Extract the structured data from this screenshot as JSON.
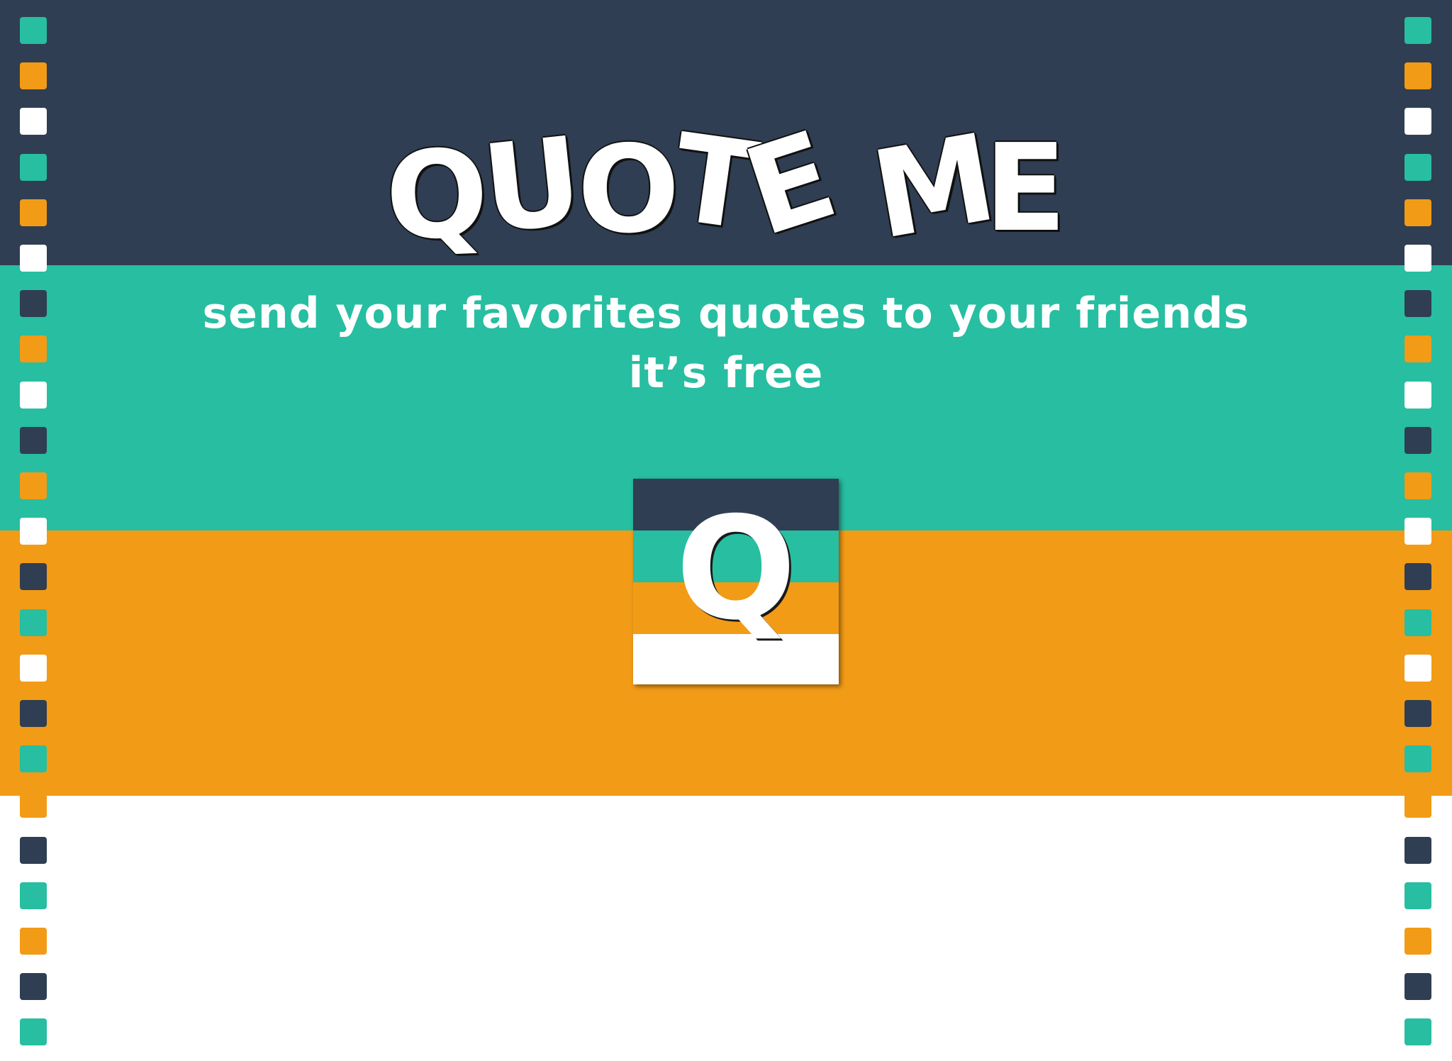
{
  "colors": {
    "navy": "#2f3e52",
    "teal": "#27bea1",
    "orange": "#f29b16",
    "white": "#ffffff"
  },
  "title": {
    "letters": [
      "Q",
      "U",
      "O",
      "T",
      "E",
      "M",
      "E"
    ],
    "text": "QUOTE ME"
  },
  "tagline": {
    "line1": "send your favorites quotes to your friends",
    "line2": "it’s free"
  },
  "logo": {
    "letter": "Q",
    "icon": "quote-me-app-icon"
  },
  "decoration": {
    "strip_pattern": [
      "teal",
      "orange",
      "white",
      "teal",
      "orange",
      "white",
      "navy",
      "orange",
      "white",
      "navy",
      "orange",
      "white",
      "navy",
      "teal",
      "white",
      "navy",
      "teal",
      "orange",
      "navy",
      "teal",
      "orange",
      "navy",
      "teal"
    ]
  }
}
